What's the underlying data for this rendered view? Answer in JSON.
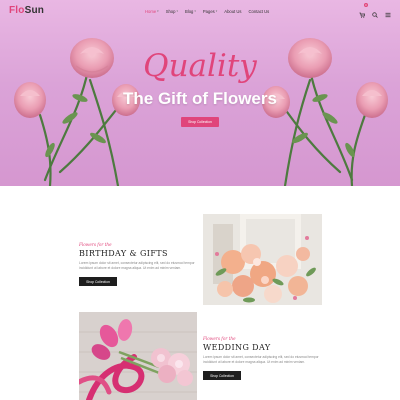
{
  "header": {
    "logo_part1": "Flo",
    "logo_part2": "Sun",
    "cart_count": "0",
    "nav": [
      {
        "label": "Home",
        "active": true,
        "has_caret": true
      },
      {
        "label": "Shop",
        "active": false,
        "has_caret": true
      },
      {
        "label": "Blog",
        "active": false,
        "has_caret": true
      },
      {
        "label": "Pages",
        "active": false,
        "has_caret": true
      },
      {
        "label": "About Us",
        "active": false,
        "has_caret": false
      },
      {
        "label": "Contact Us",
        "active": false,
        "has_caret": false
      }
    ],
    "icons": [
      "cart-icon",
      "search-icon",
      "menu-icon"
    ]
  },
  "hero": {
    "script_text": "Quality",
    "title": "The Gift of Flowers",
    "button_label": "Shop Collection"
  },
  "section1": {
    "kicker": "Flowers for the",
    "title": "BIRTHDAY & GIFTS",
    "text": "Lorem ipsum dolor sit amet, consectetur adipiscing elit, sed do eiusmod tempor incididunt ut labore et dolore magna aliqua. Ut enim ad minim veniam.",
    "button_label": "Shop Collection"
  },
  "section2": {
    "kicker": "Flowers for the",
    "title": "WEDDING DAY",
    "text": "Lorem ipsum dolor sit amet, consectetur adipiscing elit, sed do eiusmod tempor incididunt ut labore et dolore magna aliqua. Ut enim ad minim veniam.",
    "button_label": "Shop Collection"
  },
  "colors": {
    "accent": "#e0457b",
    "hero_bg": "#dba3d8",
    "dark_button": "#1e1e1e"
  }
}
